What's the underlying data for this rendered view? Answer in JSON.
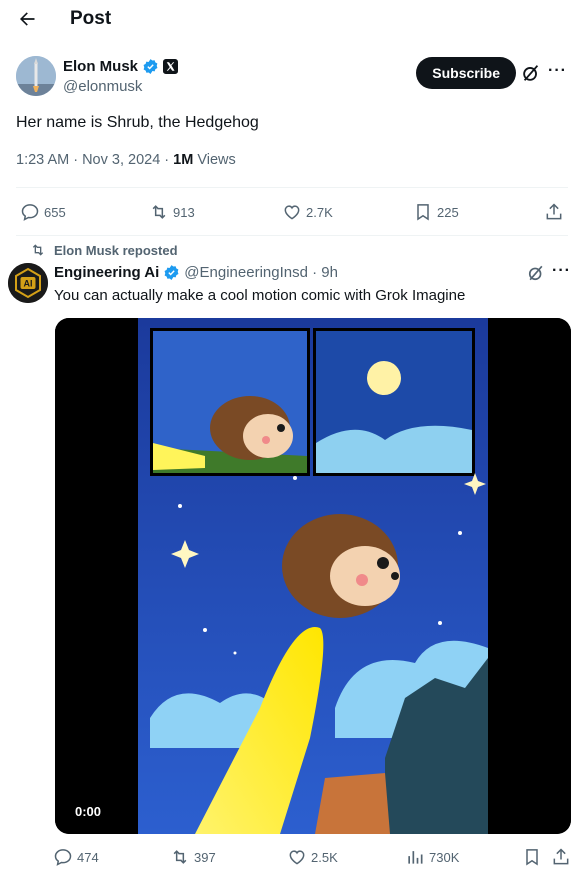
{
  "header": {
    "title": "Post"
  },
  "post": {
    "author_name": "Elon Musk",
    "author_handle": "@elonmusk",
    "subscribe_label": "Subscribe",
    "text": "Her name is Shrub, the Hedgehog",
    "time": "1:23 AM · Nov 3, 2024 · ",
    "views_count": "1M",
    "views_label": " Views",
    "actions": {
      "replies": "655",
      "reposts": "913",
      "likes": "2.7K",
      "bookmarks": "225"
    }
  },
  "repost_note": "Elon Musk reposted",
  "quoted": {
    "author_name": "Engineering Ai",
    "author_handle": "@EngineeringInsd · 9h",
    "avatar_text": "AI",
    "text": "You can actually make a cool motion comic with Grok Imagine",
    "video_time": "0:00",
    "actions": {
      "replies": "474",
      "reposts": "397",
      "likes": "2.5K",
      "views": "730K"
    }
  },
  "colors": {
    "accent": "#1d9bf0",
    "muted": "#536471",
    "text": "#0f1419",
    "gold": "#d4a017"
  },
  "icons": [
    "back-arrow-icon",
    "verified-badge-icon",
    "x-logo-icon",
    "grok-icon",
    "more-icon",
    "reply-icon",
    "repost-icon",
    "like-icon",
    "bookmark-icon",
    "share-icon",
    "views-icon"
  ]
}
